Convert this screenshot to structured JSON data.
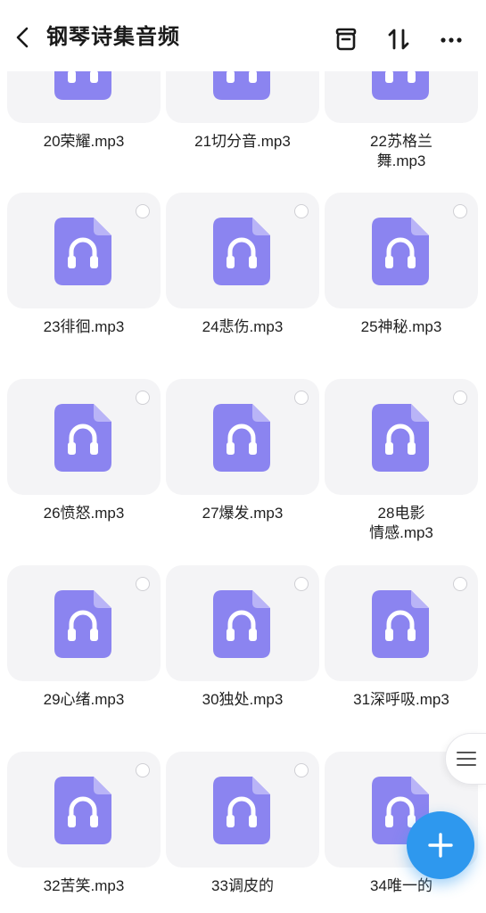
{
  "header": {
    "title": "钢琴诗集音频",
    "icons": [
      "back-icon",
      "archive-icon",
      "sort-icon",
      "more-icon"
    ]
  },
  "files": [
    {
      "name": "20荣耀.mp3",
      "line1": "20荣耀.mp3",
      "line2": ""
    },
    {
      "name": "21切分音.mp3",
      "line1": "21切分音.mp3",
      "line2": ""
    },
    {
      "name": "22苏格兰舞.mp3",
      "line1": "22苏格兰",
      "line2": "舞.mp3"
    },
    {
      "name": "23徘徊.mp3",
      "line1": "23徘徊.mp3",
      "line2": ""
    },
    {
      "name": "24悲伤.mp3",
      "line1": "24悲伤.mp3",
      "line2": ""
    },
    {
      "name": "25神秘.mp3",
      "line1": "25神秘.mp3",
      "line2": ""
    },
    {
      "name": "26愤怒.mp3",
      "line1": "26愤怒.mp3",
      "line2": ""
    },
    {
      "name": "27爆发.mp3",
      "line1": "27爆发.mp3",
      "line2": ""
    },
    {
      "name": "28电影情感.mp3",
      "line1": "28电影",
      "line2": "情感.mp3"
    },
    {
      "name": "29心绪.mp3",
      "line1": "29心绪.mp3",
      "line2": ""
    },
    {
      "name": "30独处.mp3",
      "line1": "30独处.mp3",
      "line2": ""
    },
    {
      "name": "31深呼吸.mp3",
      "line1": "31深呼吸.mp3",
      "line2": ""
    },
    {
      "name": "32苦笑.mp3",
      "line1": "32苦笑.mp3",
      "line2": ""
    },
    {
      "name": "33调皮的",
      "line1": "33调皮的",
      "line2": ""
    },
    {
      "name": "34唯一的",
      "line1": "34唯一的",
      "line2": ""
    }
  ],
  "colors": {
    "file_icon": "#8b84f0",
    "file_icon_fold": "#b9b4f7",
    "fab": "#2e98ee",
    "card_bg": "#f4f4f6"
  }
}
